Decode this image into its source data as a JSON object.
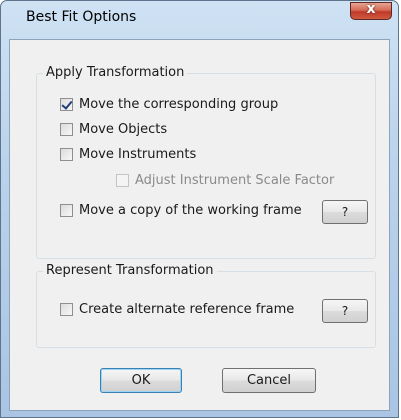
{
  "window": {
    "title": "Best Fit Options",
    "close_glyph": "x"
  },
  "apply_group": {
    "legend": "Apply Transformation",
    "options": [
      {
        "label": "Move the corresponding group",
        "checked": true,
        "enabled": true
      },
      {
        "label": "Move Objects",
        "checked": false,
        "enabled": true
      },
      {
        "label": "Move Instruments",
        "checked": false,
        "enabled": true
      },
      {
        "label": "Adjust Instrument Scale Factor",
        "checked": false,
        "enabled": false
      },
      {
        "label": "Move a copy of the working frame",
        "checked": false,
        "enabled": true
      }
    ],
    "help_label": "?"
  },
  "represent_group": {
    "legend": "Represent Transformation",
    "option": {
      "label": "Create alternate reference frame",
      "checked": false,
      "enabled": true
    },
    "help_label": "?"
  },
  "buttons": {
    "ok_label": "OK",
    "cancel_label": "Cancel"
  }
}
